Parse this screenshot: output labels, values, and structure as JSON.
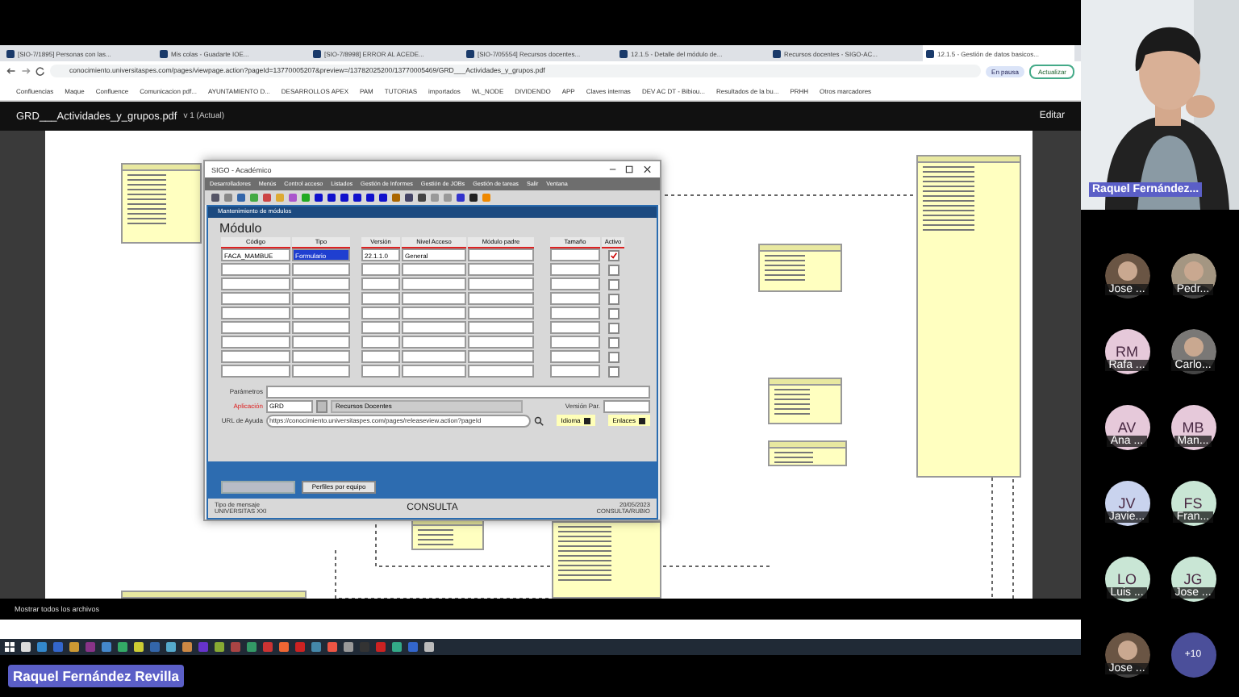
{
  "browser": {
    "tabs": [
      {
        "title": "[SIO-7/1895] Personas con las...",
        "selected": false
      },
      {
        "title": "Mis colas - Guadarte IOE...",
        "selected": false
      },
      {
        "title": "[SIO-7/8998] ERROR AL ACEDE...",
        "selected": false
      },
      {
        "title": "[SIO-7/05554] Recursos docentes...",
        "selected": false
      },
      {
        "title": "12.1.5 - Detalle del módulo de...",
        "selected": false
      },
      {
        "title": "Recursos docentes - SIGO-AC...",
        "selected": false
      },
      {
        "title": "12.1.5 - Gestión de datos basicos...",
        "selected": true
      }
    ],
    "address": "conocimiento.universitaspes.com/pages/viewpage.action?pageId=13770005207&preview=/13782025200/13770005469/GRD___Actividades_y_grupos.pdf",
    "profile": "En pausa",
    "update": "Actualizar",
    "bookmarks": [
      "Confluencias",
      "Maque",
      "Confluence",
      "Comunicacion pdf...",
      "AYUNTAMIENTO D...",
      "DESARROLLOS APEX",
      "PAM",
      "TUTORIAS",
      "importados",
      "WL_NODE",
      "DIVIDENDO",
      "APP",
      "Claves internas",
      "DEV AC DT - Bibiou...",
      "Resultados de la bu...",
      "PRHH",
      "Otros marcadores"
    ]
  },
  "pdf_viewer": {
    "file": "GRD___Actividades_y_grupos.pdf",
    "version": "v 1 (Actual)",
    "edit": "Editar"
  },
  "app_window": {
    "title": "SIGO - Académico",
    "menu": [
      "Desarrolladores",
      "Menús",
      "Control acceso",
      "Listados",
      "Gestión de Informes",
      "Gestión de JOBs",
      "Gestión de tareas",
      "Salir",
      "Ventana"
    ],
    "form_title": "Mantenimiento de módulos",
    "heading": "Módulo",
    "columns": [
      "Código",
      "Tipo",
      "Versión",
      "Nivel Acceso",
      "Módulo padre",
      "Tamaño",
      "Activo"
    ],
    "rows": [
      {
        "codigo": "FACA_MAMBUE",
        "tipo": "Formulario",
        "version": "22.1.1.0",
        "nivel": "General",
        "highlighted": true,
        "checked": true
      },
      {
        "highlighted": false,
        "checked": false
      },
      {
        "highlighted": false,
        "checked": false
      },
      {
        "highlighted": false,
        "checked": false
      },
      {
        "highlighted": false,
        "checked": false
      },
      {
        "highlighted": false,
        "checked": false
      },
      {
        "highlighted": false,
        "checked": false
      },
      {
        "highlighted": false,
        "checked": false
      },
      {
        "highlighted": false,
        "checked": false
      }
    ],
    "fields": [
      {
        "label": "Parámetros",
        "required": false
      },
      {
        "label": "Aplicación",
        "value": "GRD",
        "detail": "Recursos Docentes",
        "required": true,
        "extra_label": "Versión Par."
      },
      {
        "label": "URL de Ayuda",
        "value": "https://conocimiento.universitaspes.com/pages/releaseview.action?pageId",
        "required": false,
        "buttons": [
          "Idioma",
          "Enlaces"
        ]
      }
    ],
    "actions": [
      {
        "disabled": true
      },
      {
        "label": "Perfiles por equipo",
        "disabled": false
      }
    ],
    "status": {
      "message_type": "Tipo de mensaje",
      "org": "UNIVERSITAS XXI",
      "mode": "CONSULTA",
      "date": "20/05/2023",
      "user": "CONSULTA/RUBIO"
    }
  },
  "downloads": {
    "label": "Mostrar todos los archivos"
  },
  "meeting": {
    "speaker": "Raquel Fernández...",
    "presenter": "Raquel Fernández Revilla",
    "more": "+10",
    "participants": [
      {
        "kind": "picture",
        "name": "Jose ..."
      },
      {
        "kind": "picture",
        "name": "Pedr..."
      },
      {
        "kind": "initials",
        "initials": "RM",
        "name": "Rafa ...",
        "color": "#e6c9da"
      },
      {
        "kind": "picture",
        "name": "Carlo..."
      },
      {
        "kind": "initials",
        "initials": "AV",
        "name": "Ana ...",
        "color": "#e6c9da"
      },
      {
        "kind": "initials",
        "initials": "MB",
        "name": "Man...",
        "color": "#e6c9da"
      },
      {
        "kind": "initials",
        "initials": "JV",
        "name": "Javie...",
        "color": "#c9d3ee"
      },
      {
        "kind": "initials",
        "initials": "FS",
        "name": "Fran...",
        "color": "#c9e6d5"
      },
      {
        "kind": "initials",
        "initials": "LO",
        "name": "Luis ...",
        "color": "#c9e6d5"
      },
      {
        "kind": "initials",
        "initials": "JG",
        "name": "Jose ...",
        "color": "#c9e6d5"
      },
      {
        "kind": "picture",
        "name": "Jose ..."
      }
    ]
  }
}
